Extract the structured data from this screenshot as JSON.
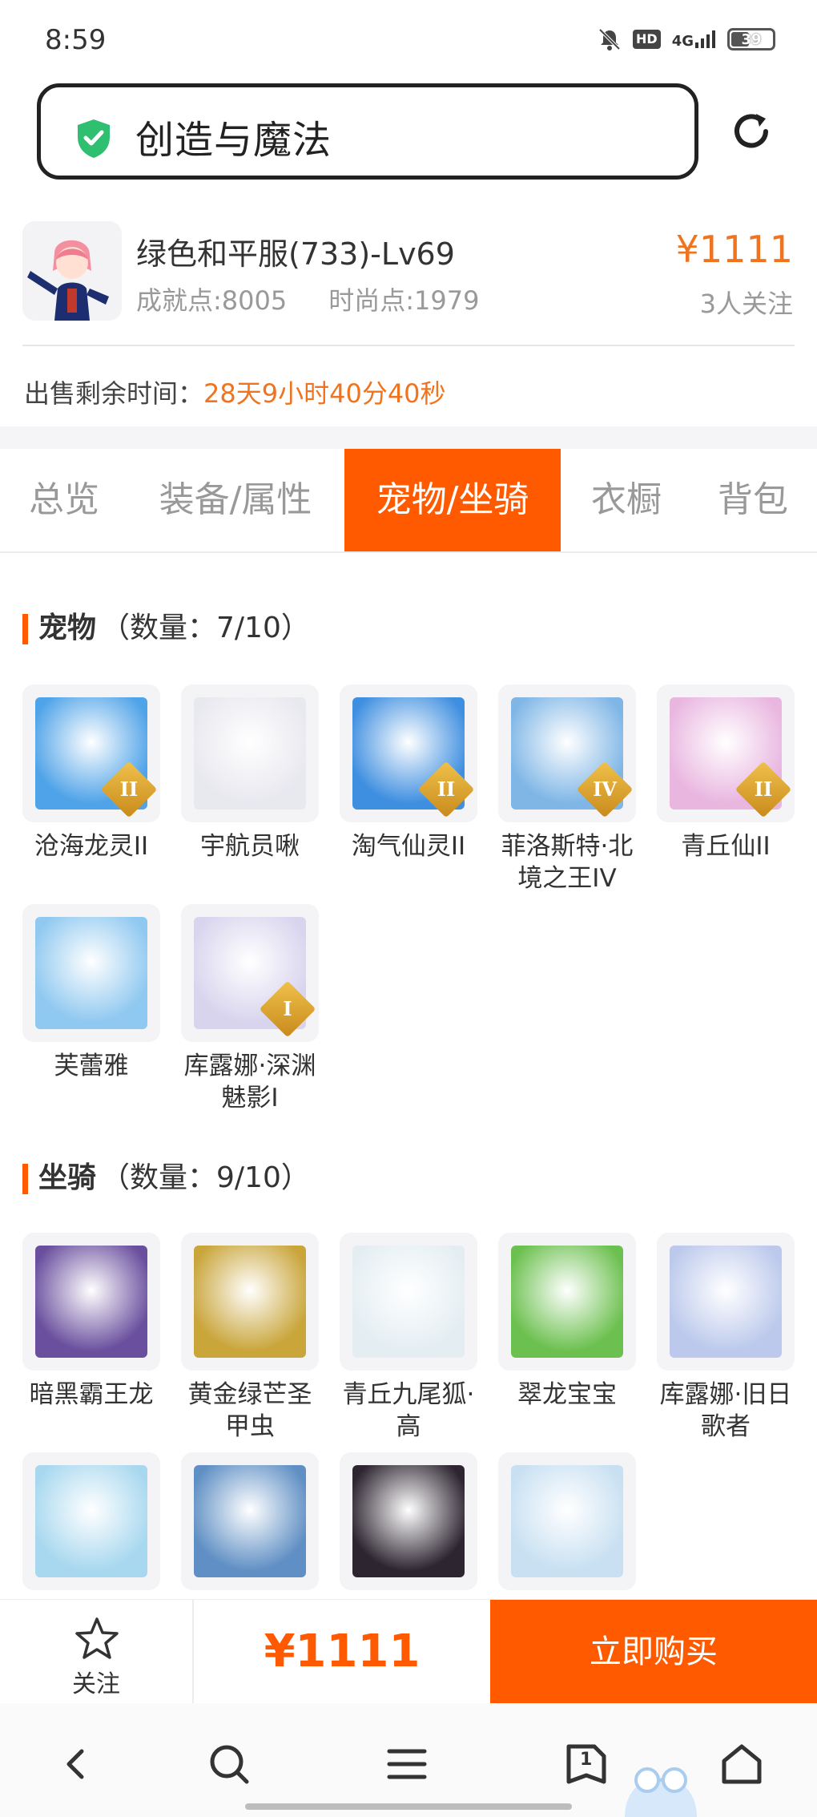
{
  "status": {
    "time": "8:59",
    "hd": "HD",
    "network": "4G",
    "battery": "39"
  },
  "search": {
    "text": "创造与魔法"
  },
  "product": {
    "name": "绿色和平服(733)-Lv69",
    "achievement": "成就点:8005",
    "fashion": "时尚点:1979",
    "price": "¥1111",
    "followers": "3人关注",
    "remain_label": "出售剩余时间：",
    "remain_value": "28天9小时40分40秒"
  },
  "tabs": [
    "总览",
    "装备/属性",
    "宠物/坐骑",
    "衣橱",
    "背包"
  ],
  "active_tab": "宠物/坐骑",
  "pets": {
    "title": "宠物",
    "count": "（数量：7/10）",
    "items": [
      {
        "name": "沧海龙灵II",
        "badge": "II",
        "color": "#4fa3e8"
      },
      {
        "name": "宇航员啾",
        "badge": "",
        "color": "#e8e8ef"
      },
      {
        "name": "淘气仙灵II",
        "badge": "II",
        "color": "#3f8fe0"
      },
      {
        "name": "菲洛斯特·北境之王IV",
        "badge": "IV",
        "color": "#7fb6e6"
      },
      {
        "name": "青丘仙II",
        "badge": "II",
        "color": "#e9b6e0"
      },
      {
        "name": "芙蕾雅",
        "badge": "",
        "color": "#8fc8f0"
      },
      {
        "name": "库露娜·深渊魅影I",
        "badge": "I",
        "color": "#d9d4ee"
      }
    ]
  },
  "mounts": {
    "title": "坐骑",
    "count": "（数量：9/10）",
    "items": [
      {
        "name": "暗黑霸王龙",
        "color": "#6a4f9e"
      },
      {
        "name": "黄金绿芒圣甲虫",
        "color": "#c9a53a"
      },
      {
        "name": "青丘九尾狐·高",
        "color": "#e4eef2"
      },
      {
        "name": "翠龙宝宝",
        "color": "#6cc04f"
      },
      {
        "name": "库露娜·旧日歌者",
        "color": "#bcc9ec"
      },
      {
        "name": "",
        "color": "#a8d8ef"
      },
      {
        "name": "",
        "color": "#5f8fc4"
      },
      {
        "name": "",
        "color": "#2d2530"
      },
      {
        "name": "",
        "color": "#c8e0f2"
      }
    ]
  },
  "actions": {
    "follow": "关注",
    "price": "¥1111",
    "buy": "立即购买"
  },
  "nav": {
    "tab_count": "1"
  },
  "colors": {
    "accent": "#ff5a00",
    "price": "#f0741f"
  }
}
